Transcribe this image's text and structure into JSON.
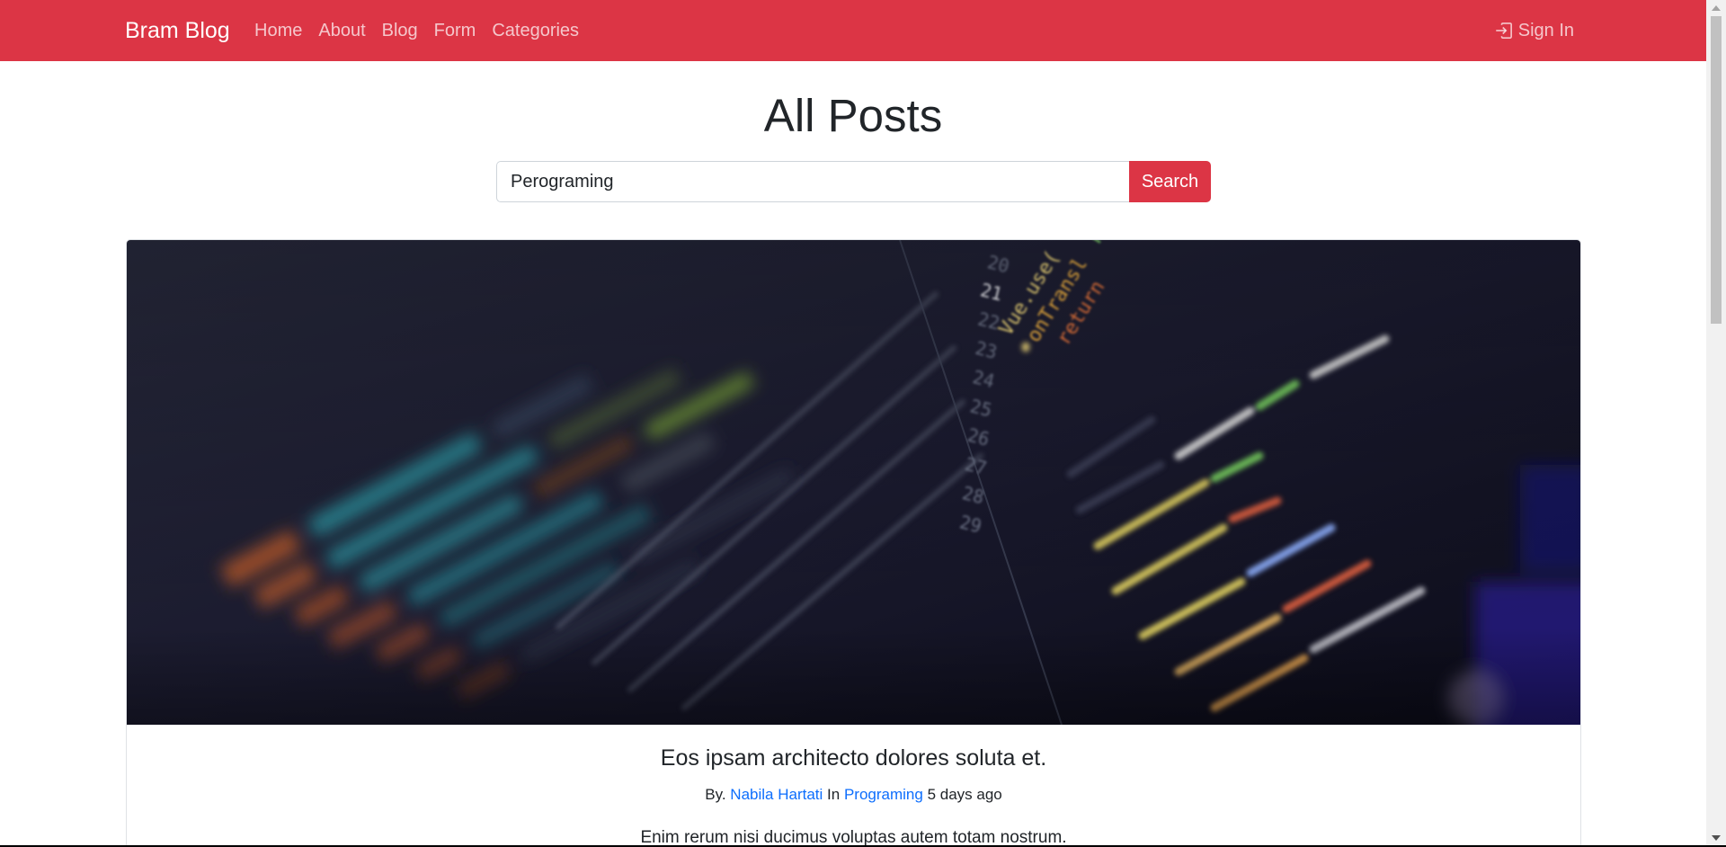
{
  "navbar": {
    "brand": "Bram Blog",
    "links": [
      "Home",
      "About",
      "Blog",
      "Form",
      "Categories"
    ],
    "signin_label": "Sign In",
    "background": "#dc3545"
  },
  "page": {
    "title": "All Posts"
  },
  "search": {
    "value": "Perograming",
    "button_label": "Search"
  },
  "post": {
    "title": "Eos ipsam architecto dolores soluta et.",
    "meta_by": "By.",
    "author": "Nabila Hartati",
    "meta_in": "In",
    "category": "Programing",
    "time": "5 days ago",
    "excerpt": "Enim rerum nisi ducimus voluptas autem totam nostrum.",
    "image_icon": "code-screen-image"
  },
  "colors": {
    "accent": "#dc3545",
    "link": "#0d6efd",
    "text": "#212529"
  }
}
